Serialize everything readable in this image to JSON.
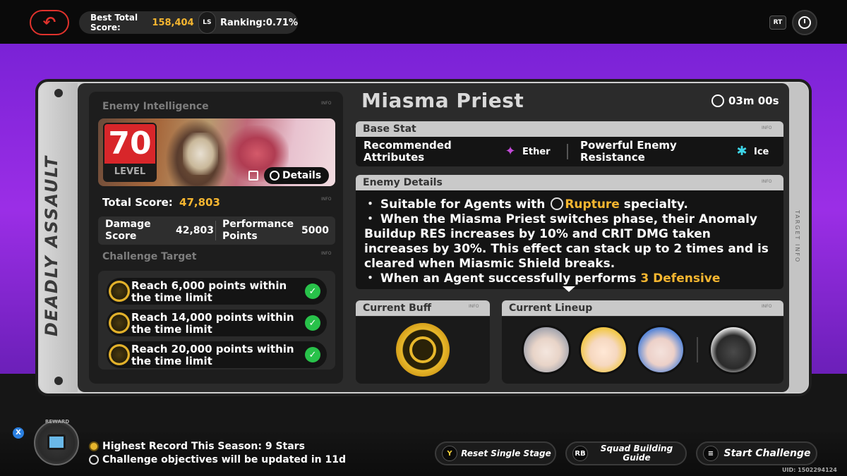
{
  "top_bar": {
    "best_total_score_label": "Best Total Score:",
    "best_total_score_value": "158,404",
    "ls_key": "LS",
    "ranking": "Ranking:0.71%",
    "rt_key": "RT"
  },
  "side": {
    "title": "DEADLY ASSAULT",
    "right_label": "TARGET INFO"
  },
  "left_panel": {
    "enemy_intelligence_label": "Enemy Intelligence",
    "info_tag": "INFO",
    "level_number": "70",
    "level_label": "LEVEL",
    "details_label": "Details",
    "total_score_label": "Total Score:",
    "total_score_value": "47,803",
    "damage_score_label": "Damage Score",
    "damage_score_value": "42,803",
    "performance_points_label": "Performance Points",
    "performance_points_value": "5000",
    "challenge_target_label": "Challenge Target",
    "targets": [
      {
        "text": "Reach 6,000 points within the time limit",
        "completed": true
      },
      {
        "text": "Reach 14,000 points within the time limit",
        "completed": true
      },
      {
        "text": "Reach 20,000 points within the time limit",
        "completed": true
      }
    ]
  },
  "right_panel": {
    "enemy_name": "Miasma Priest",
    "timer": "03m 00s",
    "base_stat_label": "Base Stat",
    "recommended_attributes_label": "Recommended Attributes",
    "recommended_attribute": "Ether",
    "powerful_enemy_resistance_label": "Powerful Enemy Resistance",
    "resistance_attribute": "Ice",
    "enemy_details_label": "Enemy Details",
    "details": {
      "line1_pre": "・ Suitable for Agents with",
      "line1_hl": "Rupture",
      "line1_post": "specialty.",
      "para2": "・ When the Miasma Priest switches phase, their Anomaly Buildup RES increases by 10% and CRIT DMG taken increases by 30%. This effect can stack up to 2 times and is cleared when Miasmic Shield breaks.",
      "line3_pre": "・ When an Agent successfully performs",
      "line3_hl": "3 Defensive"
    },
    "current_buff_label": "Current Buff",
    "current_lineup_label": "Current Lineup"
  },
  "bottom_bar": {
    "x_key": "X",
    "reward_label": "REWARD",
    "highest_record": "Highest Record This Season: 9 Stars",
    "objectives_update": "Challenge objectives will be updated in  11d",
    "reset_key": "Y",
    "reset_label": "Reset Single Stage",
    "squad_key": "RB",
    "squad_label": "Squad Building Guide",
    "start_label": "Start Challenge",
    "uid": "UID: 1502294124"
  },
  "colors": {
    "accent_gold": "#f6b630",
    "level_red": "#d8262a",
    "check_green": "#28c24a",
    "background_purple": "#9b2ee6"
  }
}
